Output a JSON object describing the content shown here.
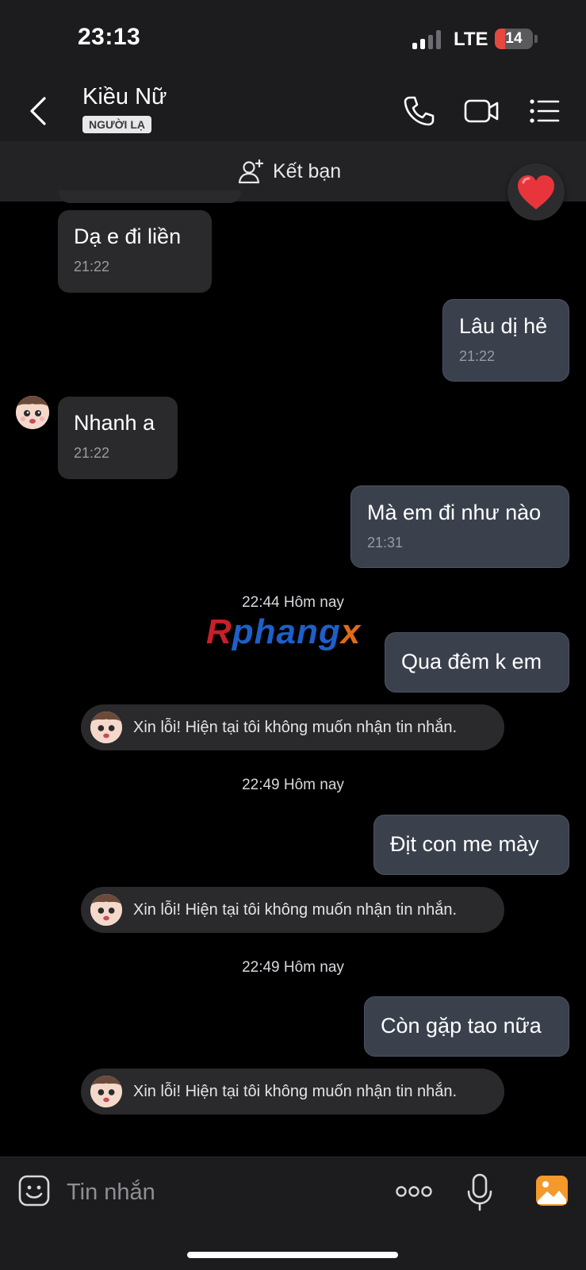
{
  "status": {
    "time": "23:13",
    "network": "LTE",
    "battery": "14",
    "battery_level": 0.14
  },
  "header": {
    "name": "Kiều Nữ",
    "badge": "NGƯỜI LẠ",
    "icons": [
      "back-icon",
      "phone-icon",
      "video-icon",
      "menu-list-icon"
    ]
  },
  "add_friend": {
    "label": "Kết bạn",
    "icon": "add-user-icon",
    "reaction": "heart"
  },
  "messages": [
    {
      "side": "in",
      "text": "Dạ e đi liền",
      "time": "21:22"
    },
    {
      "side": "out",
      "text": "Lâu dị hẻ",
      "time": "21:22"
    },
    {
      "side": "in",
      "text": "Nhanh a",
      "time": "21:22"
    },
    {
      "side": "out",
      "text": "Mà em đi như nào",
      "time": "21:31"
    }
  ],
  "separators": [
    "22:44 Hôm nay",
    "22:49 Hôm nay",
    "22:49 Hôm nay"
  ],
  "late_messages": [
    "Qua đêm k em",
    "Địt con me mày",
    "Còn gặp tao nữa"
  ],
  "notice_text": "Xin lỗi! Hiện tại tôi không muốn nhận tin nhắn.",
  "watermark": "Rphangx",
  "input": {
    "placeholder": "Tin nhắn"
  },
  "colors": {
    "outgoing_bubble": "#3a414d",
    "incoming_bubble": "#2a2a2c",
    "photo_accent": "#f39a2b",
    "battery_red": "#e5483f"
  }
}
